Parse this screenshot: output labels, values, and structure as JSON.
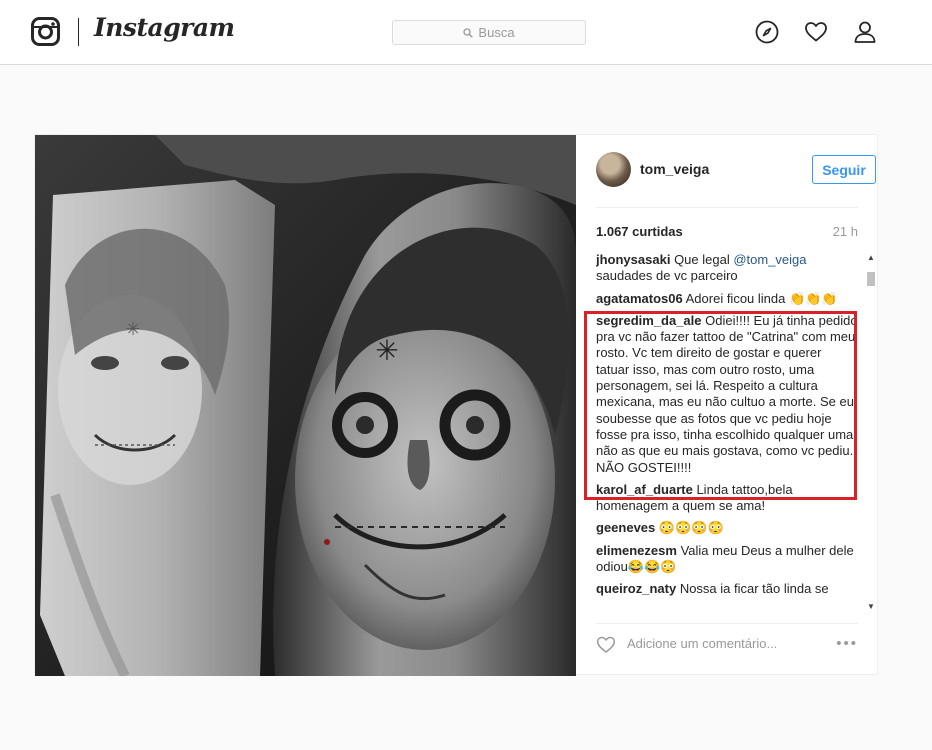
{
  "header": {
    "brand": "Instagram",
    "search_placeholder": "Busca",
    "icons": [
      "instagram-logo-icon",
      "search-icon",
      "compass-icon",
      "heart-icon",
      "user-icon"
    ]
  },
  "post": {
    "author": "tom_veiga",
    "follow_label": "Seguir",
    "likes": "1.067 curtidas",
    "time": "21 h",
    "comments": [
      {
        "user": "jhonysasaki",
        "text_before": "Que legal ",
        "mention": "@tom_veiga",
        "text_after": " saudades de vc parceiro"
      },
      {
        "user": "agatamatos06",
        "text": "Adorei ficou linda 👏👏👏"
      },
      {
        "user": "segredim_da_ale",
        "text": "Odiei!!!! Eu já tinha pedido pra vc não fazer tattoo de \"Catrina\" com meu rosto. Vc tem direito de gostar e querer tatuar isso, mas com outro rosto, uma personagem, sei lá. Respeito a cultura mexicana, mas eu não cultuo a morte. Se eu soubesse que as fotos que vc pediu hoje fosse pra isso, tinha escolhido qualquer uma, não as que eu mais gostava, como vc pediu. NÃO GOSTEI!!!!"
      },
      {
        "user": "karol_af_duarte",
        "text": "Linda tattoo,bela homenagem a quem se ama!"
      },
      {
        "user": "geeneves",
        "text": "😳😳😳😳"
      },
      {
        "user": "elimenezesm",
        "text": "Valia meu Deus a mulher dele odiou😂😂😳"
      },
      {
        "user": "queiroz_naty",
        "text": "Nossa ia ficar tão linda se"
      }
    ],
    "add_comment_placeholder": "Adicione um comentário...",
    "more_label": "•••"
  },
  "colors": {
    "accent": "#3897f0",
    "highlight": "#d92128",
    "mention": "#2a5885"
  }
}
